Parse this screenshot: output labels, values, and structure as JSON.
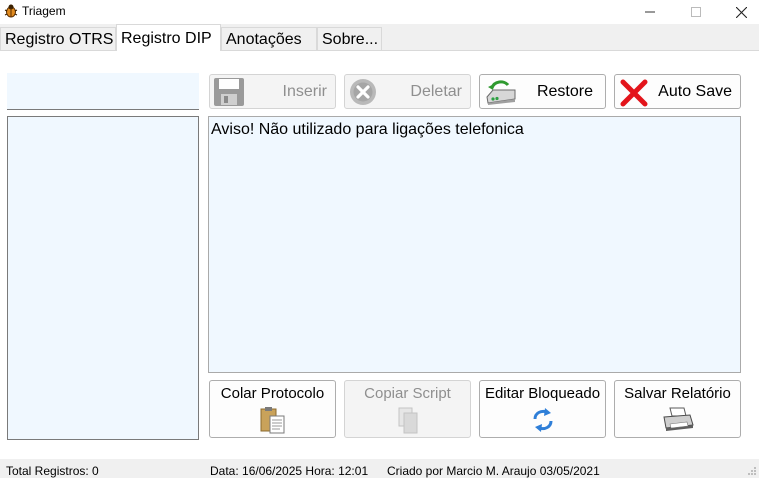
{
  "window": {
    "title": "Triagem"
  },
  "tabs": [
    {
      "label": "Registro OTRS",
      "active": false
    },
    {
      "label": "Registro DIP",
      "active": true
    },
    {
      "label": "Anotações",
      "active": false
    },
    {
      "label": "Sobre...",
      "active": false
    }
  ],
  "toolbar": {
    "inserir": {
      "label": "Inserir",
      "icon": "floppy-disk-icon",
      "enabled": false
    },
    "deletar": {
      "label": "Deletar",
      "icon": "delete-circle-icon",
      "enabled": false
    },
    "restore": {
      "label": "Restore",
      "icon": "restore-drive-icon",
      "enabled": true
    },
    "autosave": {
      "label": "Auto Save",
      "icon": "red-x-icon",
      "enabled": true
    }
  },
  "main": {
    "text": "Aviso! Não utilizado para ligações telefonica"
  },
  "bottom_buttons": {
    "colar": {
      "label": "Colar Protocolo",
      "icon": "clipboard-icon",
      "enabled": true
    },
    "copiar": {
      "label": "Copiar Script",
      "icon": "copy-pages-icon",
      "enabled": false
    },
    "editar": {
      "label": "Editar Bloqueado",
      "icon": "refresh-arrows-icon",
      "enabled": true
    },
    "salvar": {
      "label": "Salvar Relatório",
      "icon": "printer-icon",
      "enabled": true
    }
  },
  "status": {
    "total": "Total Registros: 0",
    "datetime": "Data: 16/06/2025 Hora: 12:01",
    "credit": "Criado por Marcio M. Araujo 03/05/2021"
  },
  "colors": {
    "list_background": "#f0f8ff",
    "autosave_x": "#e3141b",
    "refresh_arrows": "#2f7fd8"
  }
}
